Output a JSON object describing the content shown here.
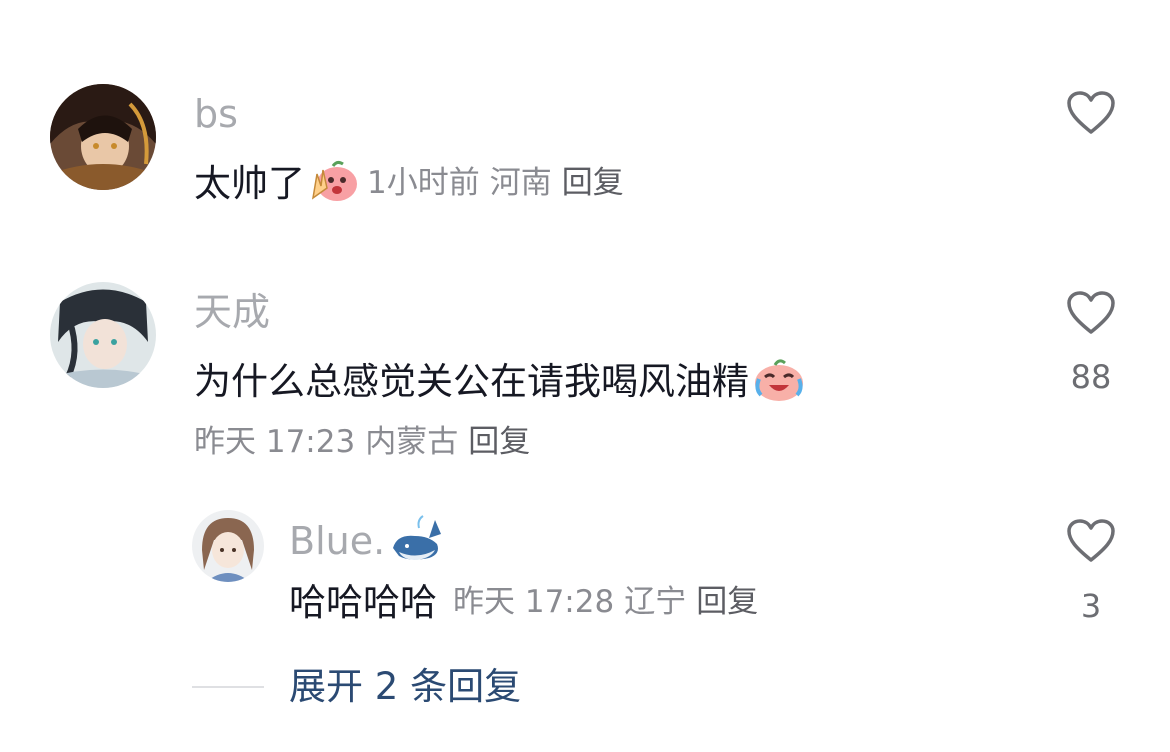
{
  "comments": [
    {
      "username": "bs",
      "text": "太帅了",
      "emoji": "cheering-emoji",
      "time": "1小时前",
      "location": "河南",
      "reply_label": "回复",
      "like_count": ""
    },
    {
      "username": "天成",
      "text": "为什么总感觉关公在请我喝风油精",
      "emoji": "laugh-cry-emoji",
      "time": "昨天 17:23",
      "location": "内蒙古",
      "reply_label": "回复",
      "like_count": "88",
      "replies": [
        {
          "username": "Blue.",
          "username_emoji": "whale-emoji",
          "text": "哈哈哈哈",
          "time": "昨天 17:28",
          "location": "辽宁",
          "reply_label": "回复",
          "like_count": "3"
        }
      ],
      "expand_label": "展开 2 条回复"
    }
  ],
  "colors": {
    "username": "#a7a9ae",
    "text": "#161823",
    "meta": "#8a8b91",
    "expand": "#2b4a73"
  }
}
